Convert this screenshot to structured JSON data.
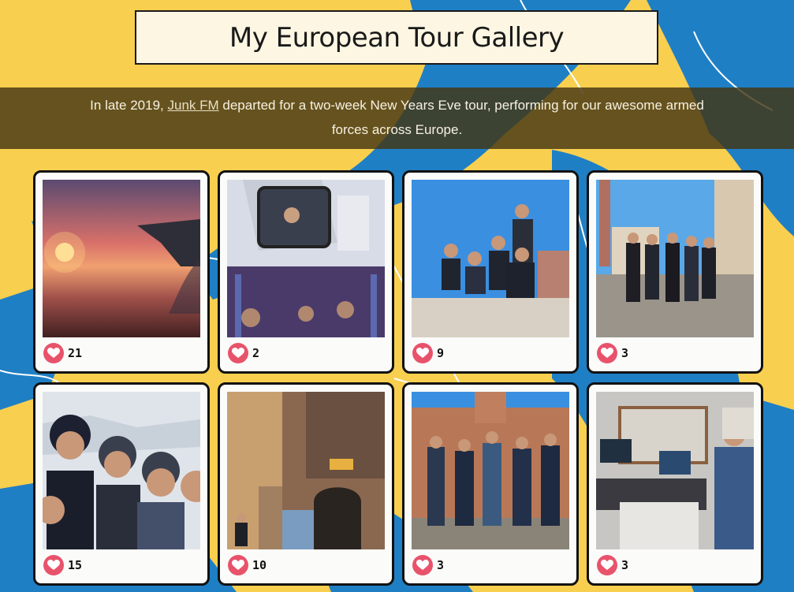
{
  "header": {
    "title": "My European Tour Gallery"
  },
  "intro": {
    "before": "In late 2019, ",
    "link": "Junk FM",
    "after": " departed for a two-week New Years Eve tour, performing for our awesome armed forces across Europe."
  },
  "colors": {
    "background": "#f9cf4f",
    "sea": "#1f7fc4",
    "heart": "#e8536b",
    "card": "#fbfbfa"
  },
  "gallery": {
    "photos": [
      {
        "subject": "sunset from airplane window",
        "likes": "21"
      },
      {
        "subject": "band selfie in bus mirror",
        "likes": "2"
      },
      {
        "subject": "band posing in plaza",
        "likes": "9"
      },
      {
        "subject": "band in Venice square",
        "likes": "3"
      },
      {
        "subject": "band selfie in snow",
        "likes": "15"
      },
      {
        "subject": "old town street with sign",
        "likes": "10"
      },
      {
        "subject": "band at Spanish palace",
        "likes": "3"
      },
      {
        "subject": "radio studio",
        "likes": "3"
      }
    ]
  }
}
